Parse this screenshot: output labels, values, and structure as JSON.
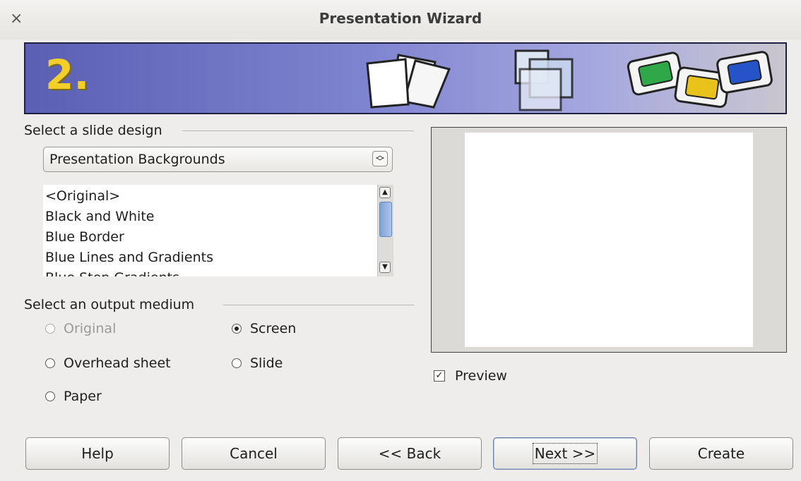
{
  "window": {
    "title": "Presentation Wizard",
    "close_glyph": "×"
  },
  "banner": {
    "step": "2."
  },
  "design": {
    "header": "Select a slide design",
    "header_mnemonic": "S",
    "category": "Presentation Backgrounds",
    "items": [
      "<Original>",
      "Black and White",
      "Blue Border",
      "Blue Lines and Gradients",
      "Blue Step Gradients"
    ]
  },
  "medium": {
    "header": "Select an output medium",
    "options": {
      "original": "Original",
      "screen": "Screen",
      "overhead": "Overhead sheet",
      "slide": "Slide",
      "paper": "Paper"
    },
    "selected": "screen"
  },
  "preview": {
    "label": "Preview",
    "checked": true
  },
  "buttons": {
    "help": "Help",
    "cancel": "Cancel",
    "back": "<< Back",
    "next": "Next >>",
    "create": "Create"
  },
  "colors": {
    "banner_left": "#5b5fb3",
    "banner_right": "#c9c6cf",
    "step": "#f4cf2a"
  }
}
